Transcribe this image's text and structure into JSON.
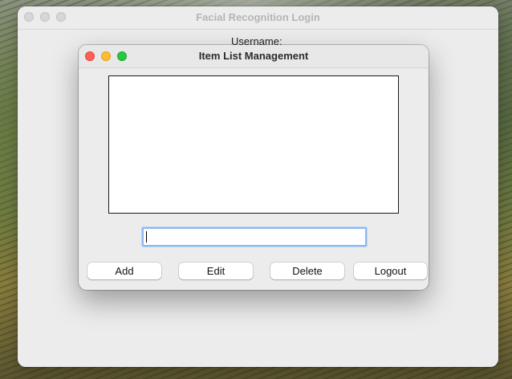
{
  "background_window": {
    "title": "Facial Recognition Login",
    "username_label": "Username:"
  },
  "dialog": {
    "title": "Item List Management",
    "list_items": [],
    "entry_value": "",
    "buttons": {
      "add": "Add",
      "edit": "Edit",
      "delete": "Delete",
      "logout": "Logout"
    }
  },
  "colors": {
    "close": "#ff5f57",
    "minimize": "#febc2e",
    "zoom": "#28c840",
    "focus_ring": "#8cbaf0"
  }
}
